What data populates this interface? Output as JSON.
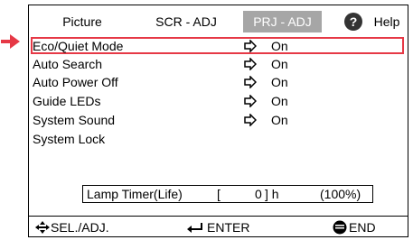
{
  "tabs": [
    {
      "label": "Picture",
      "active": false
    },
    {
      "label": "SCR - ADJ",
      "active": false
    },
    {
      "label": "PRJ - ADJ",
      "active": true
    },
    {
      "label": "Help",
      "active": false
    }
  ],
  "help_icon": "?",
  "menu_items": [
    {
      "label": "Eco/Quiet Mode",
      "value": "On",
      "icon": "right-arrow-icon",
      "selected": true
    },
    {
      "label": "Auto Search",
      "value": "On",
      "icon": "right-arrow-icon"
    },
    {
      "label": "Auto Power Off",
      "value": "On",
      "icon": "right-arrow-icon"
    },
    {
      "label": "Guide LEDs",
      "value": "On",
      "icon": "right-arrow-icon"
    },
    {
      "label": "System Sound",
      "value": "On",
      "icon": "right-arrow-icon"
    },
    {
      "label": "System Lock",
      "value": "",
      "icon": ""
    }
  ],
  "lamp_timer": {
    "label": "Lamp Timer(Life)",
    "open_bracket": "[",
    "hours": "0",
    "close_unit": "] h",
    "percent": "(100%)"
  },
  "footer": {
    "sel_label": "SEL./ADJ.",
    "enter_label": "ENTER",
    "end_label": "END"
  },
  "colors": {
    "highlight": "#e63946",
    "active_tab_bg": "#a6a6a6",
    "text": "#000000"
  }
}
